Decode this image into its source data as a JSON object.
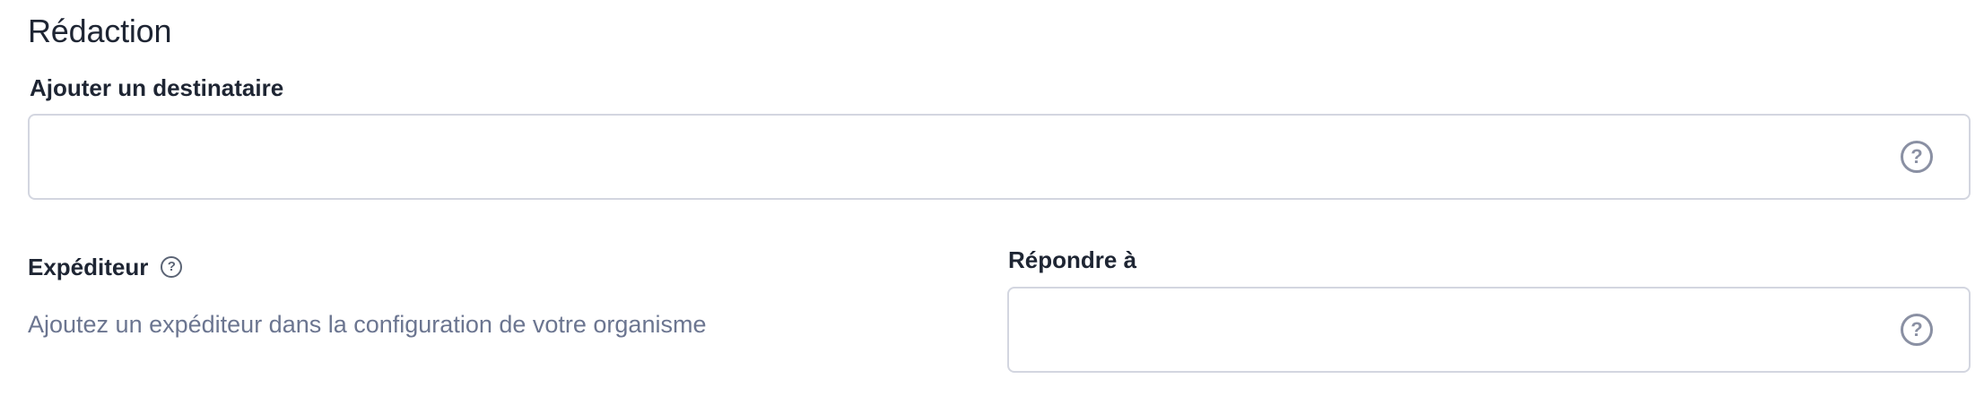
{
  "section": {
    "title": "Rédaction"
  },
  "recipient": {
    "label": "Ajouter un destinataire",
    "value": "",
    "placeholder": "",
    "help_icon": "question-circle-icon"
  },
  "sender": {
    "label": "Expéditeur",
    "help_icon": "question-circle-icon",
    "hint": "Ajoutez un expéditeur dans la configuration de votre organisme"
  },
  "reply_to": {
    "label": "Répondre à",
    "value": "",
    "placeholder": "",
    "help_icon": "question-circle-icon"
  },
  "colors": {
    "text_primary": "#1e2533",
    "text_muted": "#6b7590",
    "border": "#d3d6e0",
    "icon": "#8a90a3"
  }
}
